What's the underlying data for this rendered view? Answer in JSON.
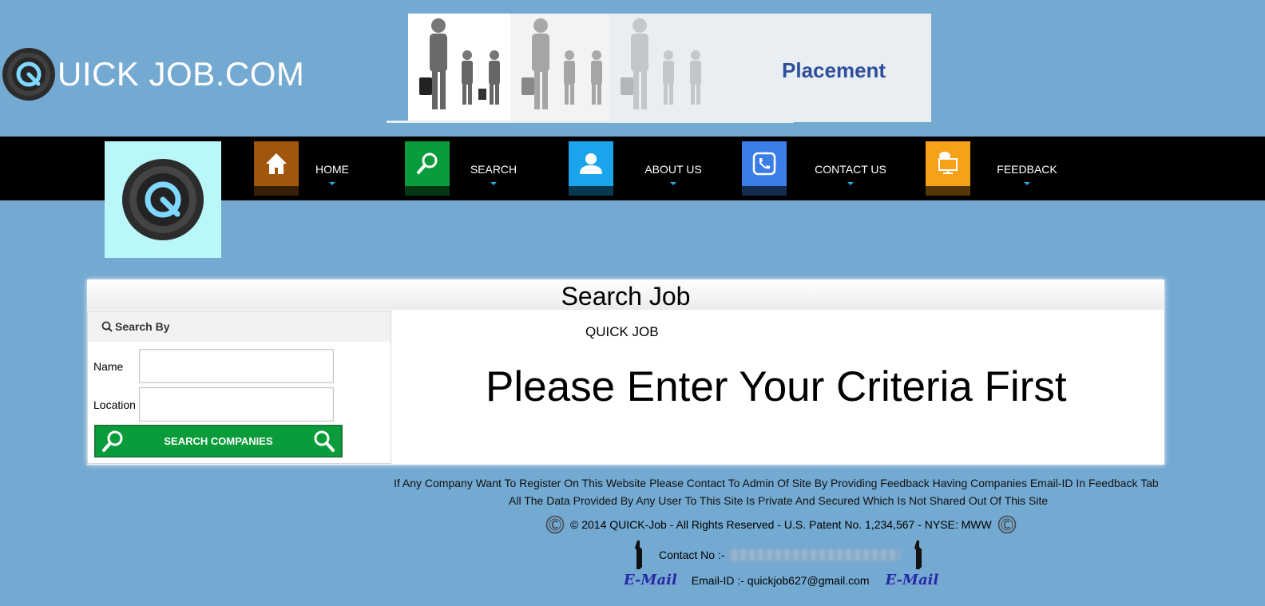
{
  "header": {
    "brand_text": "UICK JOB.COM",
    "banner_text": "Placement"
  },
  "nav": {
    "items": [
      {
        "label": "HOME",
        "icon": "home-icon",
        "color": "#a0570d"
      },
      {
        "label": "SEARCH",
        "icon": "search-icon",
        "color": "#0a9c3a"
      },
      {
        "label": "ABOUT US",
        "icon": "user-icon",
        "color": "#1aa4ec"
      },
      {
        "label": "CONTACT US",
        "icon": "phone-icon",
        "color": "#3c7ee8"
      },
      {
        "label": "FEEDBACK",
        "icon": "monitor-chat-icon",
        "color": "#f6a118"
      }
    ]
  },
  "panel": {
    "title": "Search Job",
    "sidebar": {
      "title": "Search By",
      "name_label": "Name",
      "name_value": "",
      "location_label": "Location",
      "location_value": "",
      "button_label": "SEARCH COMPANIES"
    },
    "quick_job_label": "QUICK JOB",
    "message": "Please Enter Your Criteria First"
  },
  "footer": {
    "line1": "If Any Company Want To Register On This Website Please Contact To Admin Of Site By Providing Feedback Having Companies Email-ID In Feedback Tab",
    "line2": "All The Data Provided By Any User To This Site Is Private And Secured Which Is Not Shared Out Of This Site",
    "copyright": "© 2014 QUICK-Job - All Rights Reserved - U.S. Patent No. 1,234,567 - NYSE: MWW",
    "contact_label": "Contact No :-",
    "email_badge": "E-Mail",
    "email_label": "Email-ID :- quickjob627@gmail.com"
  },
  "colors": {
    "background": "#74a9d1",
    "navbar": "#000000",
    "button_green": "#0a9c3a",
    "nav_logo_bg": "#baf7f9"
  }
}
